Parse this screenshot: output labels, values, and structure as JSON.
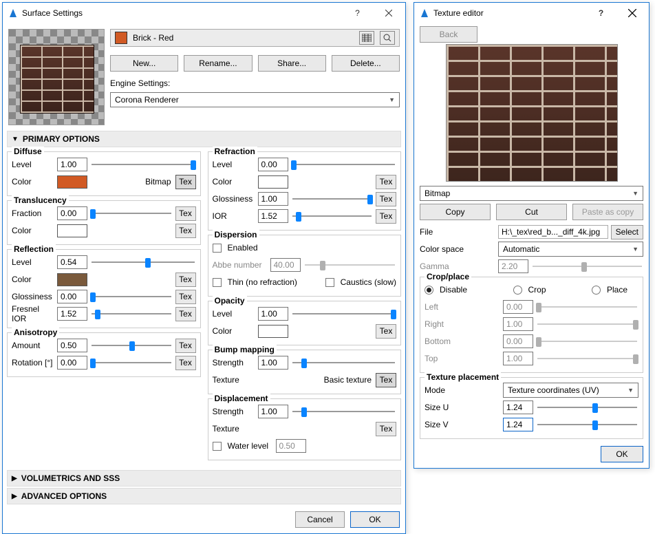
{
  "surface": {
    "title": "Surface Settings",
    "material_name": "Brick - Red",
    "material_color": "#d15a24",
    "buttons": {
      "new": "New...",
      "rename": "Rename...",
      "share": "Share...",
      "delete": "Delete..."
    },
    "engine_label": "Engine Settings:",
    "engine_value": "Corona Renderer",
    "sections": {
      "primary": "PRIMARY OPTIONS",
      "vol": "VOLUMETRICS AND SSS",
      "adv": "ADVANCED OPTIONS"
    },
    "diffuse": {
      "legend": "Diffuse",
      "level_l": "Level",
      "level": "1.00",
      "color_l": "Color",
      "color": "#d15a24",
      "bitmap": "Bitmap",
      "tex": "Tex"
    },
    "translucency": {
      "legend": "Translucency",
      "fraction_l": "Fraction",
      "fraction": "0.00",
      "color_l": "Color",
      "color": "#ffffff"
    },
    "reflection": {
      "legend": "Reflection",
      "level_l": "Level",
      "level": "0.54",
      "color_l": "Color",
      "color": "#7a5a3c",
      "gloss_l": "Glossiness",
      "gloss": "0.00",
      "ior_l": "Fresnel IOR",
      "ior": "1.52"
    },
    "anisotropy": {
      "legend": "Anisotropy",
      "amount_l": "Amount",
      "amount": "0.50",
      "rotation_l": "Rotation [°]",
      "rotation": "0.00"
    },
    "refraction": {
      "legend": "Refraction",
      "level_l": "Level",
      "level": "0.00",
      "color_l": "Color",
      "color": "#ffffff",
      "gloss_l": "Glossiness",
      "gloss": "1.00",
      "ior_l": "IOR",
      "ior": "1.52"
    },
    "dispersion": {
      "legend": "Dispersion",
      "enabled_l": "Enabled",
      "abbe_l": "Abbe number",
      "abbe": "40.00",
      "thin_l": "Thin (no refraction)",
      "caustics_l": "Caustics (slow)"
    },
    "opacity": {
      "legend": "Opacity",
      "level_l": "Level",
      "level": "1.00",
      "color_l": "Color",
      "color": "#ffffff"
    },
    "bump": {
      "legend": "Bump mapping",
      "strength_l": "Strength",
      "strength": "1.00",
      "texture_l": "Texture",
      "basic": "Basic texture"
    },
    "displacement": {
      "legend": "Displacement",
      "strength_l": "Strength",
      "strength": "1.00",
      "texture_l": "Texture",
      "water_l": "Water level",
      "water": "0.50"
    },
    "footer": {
      "cancel": "Cancel",
      "ok": "OK"
    }
  },
  "texeditor": {
    "title": "Texture editor",
    "back": "Back",
    "type": "Bitmap",
    "copy": "Copy",
    "cut": "Cut",
    "paste": "Paste as copy",
    "file_l": "File",
    "file": "H:\\_tex\\red_b..._diff_4k.jpg",
    "select": "Select",
    "cspace_l": "Color space",
    "cspace": "Automatic",
    "gamma_l": "Gamma",
    "gamma": "2.20",
    "crop": {
      "legend": "Crop/place",
      "disable": "Disable",
      "crop": "Crop",
      "place": "Place",
      "left_l": "Left",
      "left": "0.00",
      "right_l": "Right",
      "right": "1.00",
      "bottom_l": "Bottom",
      "bottom": "0.00",
      "top_l": "Top",
      "top": "1.00"
    },
    "placement": {
      "legend": "Texture placement",
      "mode_l": "Mode",
      "mode": "Texture coordinates (UV)",
      "sizeu_l": "Size U",
      "sizeu": "1.24",
      "sizev_l": "Size V",
      "sizev": "1.24"
    },
    "ok": "OK"
  }
}
